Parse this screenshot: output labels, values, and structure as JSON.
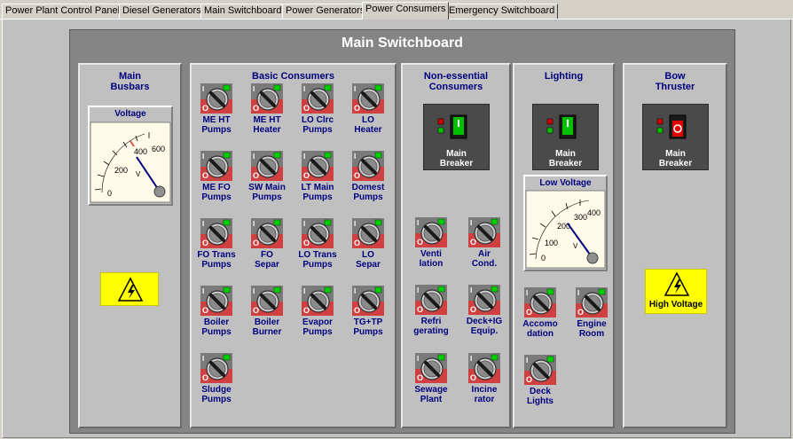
{
  "tabs": [
    {
      "label": "Power Plant Control Panel"
    },
    {
      "label": "Diesel Generators"
    },
    {
      "label": "Main Switchboard"
    },
    {
      "label": "Power Generators"
    },
    {
      "label": "Power Consumers"
    },
    {
      "label": "Emergency Switchboard"
    }
  ],
  "panel_title": "Main Switchboard",
  "sections": {
    "busbars": {
      "title_line1": "Main",
      "title_line2": "Busbars"
    },
    "basic": {
      "title": "Basic Consumers"
    },
    "nonessential": {
      "title_line1": "Non-essential",
      "title_line2": "Consumers"
    },
    "lighting": {
      "title": "Lighting"
    },
    "bow": {
      "title_line1": "Bow",
      "title_line2": "Thruster"
    }
  },
  "voltage_meter": {
    "title": "Voltage",
    "ticks": [
      "0",
      "200",
      "400",
      "600"
    ]
  },
  "low_voltage_meter": {
    "title": "Low Voltage",
    "ticks": [
      "0",
      "100",
      "200",
      "300",
      "400"
    ]
  },
  "breakers": {
    "nonessential": {
      "line1": "Main",
      "line2": "Breaker"
    },
    "lighting": {
      "line1": "Main",
      "line2": "Breaker"
    },
    "bow": {
      "line1": "Main",
      "line2": "Breaker"
    }
  },
  "high_voltage_label": "High Voltage",
  "basic_consumers": [
    {
      "l1": "ME HT",
      "l2": "Pumps"
    },
    {
      "l1": "ME HT",
      "l2": "Heater"
    },
    {
      "l1": "LO Clrc",
      "l2": "Pumps"
    },
    {
      "l1": "LO",
      "l2": "Heater"
    },
    {
      "l1": "ME FO",
      "l2": "Pumps"
    },
    {
      "l1": "SW Main",
      "l2": "Pumps"
    },
    {
      "l1": "LT Main",
      "l2": "Pumps"
    },
    {
      "l1": "Domest",
      "l2": "Pumps"
    },
    {
      "l1": "FO Trans",
      "l2": "Pumps"
    },
    {
      "l1": "FO",
      "l2": "Separ"
    },
    {
      "l1": "LO Trans",
      "l2": "Pumps"
    },
    {
      "l1": "LO",
      "l2": "Separ"
    },
    {
      "l1": "Boiler",
      "l2": "Pumps"
    },
    {
      "l1": "Boiler",
      "l2": "Burner"
    },
    {
      "l1": "Evapor",
      "l2": "Pumps"
    },
    {
      "l1": "TG+TP",
      "l2": "Pumps"
    },
    {
      "l1": "Sludge",
      "l2": "Pumps"
    }
  ],
  "nonessential_consumers": [
    {
      "l1": "Venti",
      "l2": "lation"
    },
    {
      "l1": "Air",
      "l2": "Cond."
    },
    {
      "l1": "Refri",
      "l2": "gerating"
    },
    {
      "l1": "Deck+IG",
      "l2": "Equip."
    },
    {
      "l1": "Sewage",
      "l2": "Plant"
    },
    {
      "l1": "Incine",
      "l2": "rator"
    }
  ],
  "lighting_consumers": [
    {
      "l1": "Accomo",
      "l2": "dation"
    },
    {
      "l1": "Engine",
      "l2": "Room"
    },
    {
      "l1": "Deck",
      "l2": "Lights"
    }
  ],
  "colors": {
    "panel": "#858585",
    "section": "#c0c0c0",
    "label": "#00007f",
    "warning": "#ffff00",
    "breaker_on": "#00c000",
    "breaker_off": "#e00000"
  }
}
